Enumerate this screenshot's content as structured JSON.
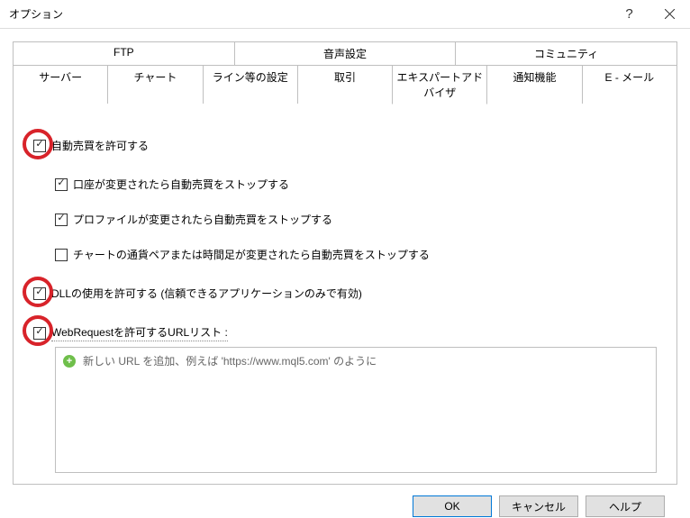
{
  "window": {
    "title": "オプション"
  },
  "tabs": {
    "top": [
      "FTP",
      "音声設定",
      "コミュニティ"
    ],
    "bottom": [
      "サーバー",
      "チャート",
      "ライン等の設定",
      "取引",
      "エキスパートアドバイザ",
      "通知機能",
      "E - メール"
    ],
    "active_bottom_index": 4
  },
  "options": {
    "allow_auto_trading": {
      "label": "自動売買を許可する",
      "checked": true,
      "circled": true
    },
    "stop_on_account_change": {
      "label": "口座が変更されたら自動売買をストップする",
      "checked": true
    },
    "stop_on_profile_change": {
      "label": "プロファイルが変更されたら自動売買をストップする",
      "checked": true
    },
    "stop_on_symbol_change": {
      "label": "チャートの通貨ペアまたは時間足が変更されたら自動売買をストップする",
      "checked": false
    },
    "allow_dll": {
      "label": "DLLの使用を許可する (信頼できるアプリケーションのみで有効)",
      "checked": true,
      "circled": true
    },
    "allow_webrequest": {
      "label": "WebRequestを許可するURLリスト :",
      "checked": true,
      "circled": true
    }
  },
  "url_list": {
    "placeholder": "新しい URL を追加、例えば 'https://www.mql5.com' のように"
  },
  "buttons": {
    "ok": "OK",
    "cancel": "キャンセル",
    "help": "ヘルプ"
  }
}
